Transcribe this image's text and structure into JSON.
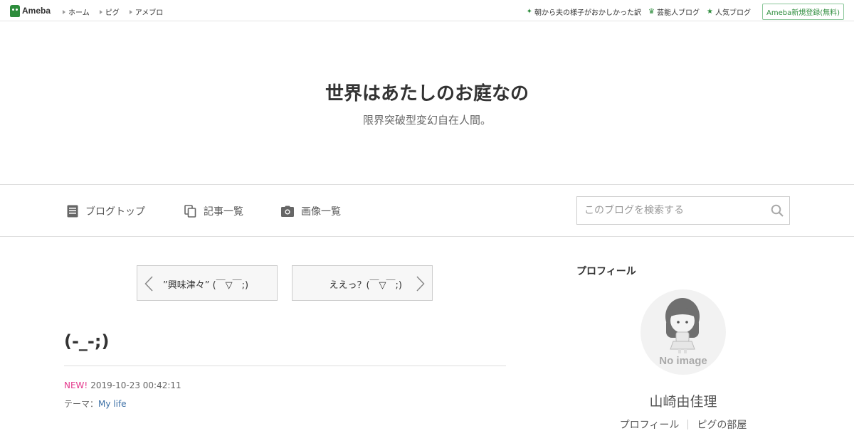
{
  "global_header": {
    "logo": "Ameba",
    "nav": [
      "ホーム",
      "ピグ",
      "アメブロ"
    ],
    "right_links": [
      {
        "label": "朝から夫の様子がおかしかった訳",
        "icon": "sparkle-icon"
      },
      {
        "label": "芸能人ブログ",
        "icon": "crown-icon"
      },
      {
        "label": "人気ブログ",
        "icon": "star-icon"
      }
    ],
    "register": "Ameba新規登録(無料)"
  },
  "blog": {
    "title": "世界はあたしのお庭なの",
    "description": "限界突破型変幻自在人間。"
  },
  "blog_nav": {
    "items": [
      {
        "label": "ブログトップ",
        "icon": "document-icon"
      },
      {
        "label": "記事一覧",
        "icon": "copy-icon"
      },
      {
        "label": "画像一覧",
        "icon": "camera-icon"
      }
    ],
    "search_placeholder": "このブログを検索する"
  },
  "article": {
    "prev_label": "”興味津々” (￣▽￣;)",
    "next_label": "ええっ？(￣▽￣;)",
    "title": "(-_-;)",
    "new_badge": "NEW!",
    "datetime": "2019-10-23 00:42:11",
    "theme_prefix": "テーマ：",
    "theme": "My life"
  },
  "sidebar": {
    "heading": "プロフィール",
    "avatar_text": "No image",
    "name": "山崎由佳理",
    "links": [
      "プロフィール",
      "ピグの部屋"
    ]
  },
  "colors": {
    "brand_green": "#2d8c3c",
    "new_pink": "#e4388c",
    "link_blue": "#3a6ea5"
  }
}
